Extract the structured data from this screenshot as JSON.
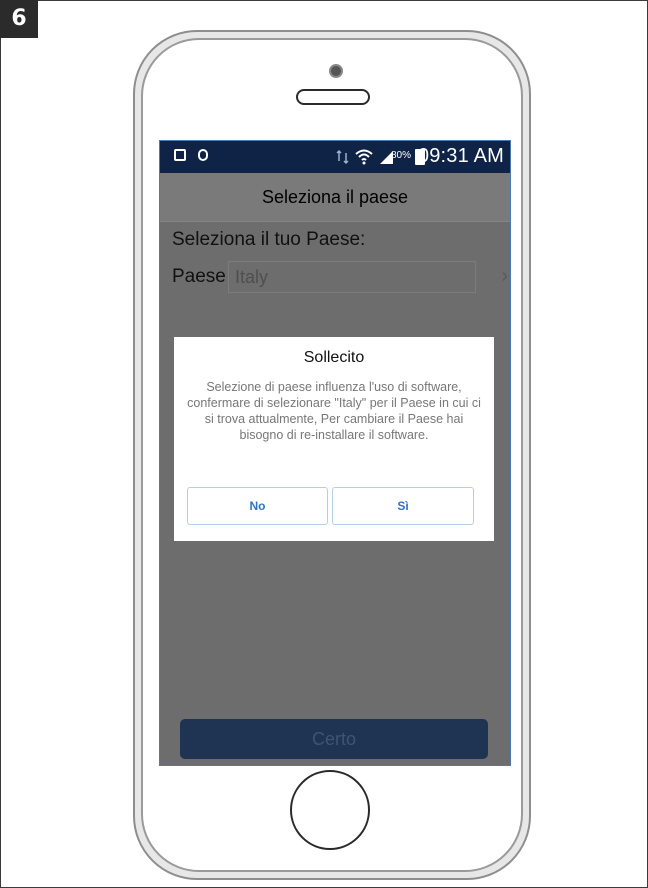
{
  "step_number": "6",
  "status_bar": {
    "battery_percent": "80%",
    "time": "09:31 AM",
    "icons": [
      "gallery-icon",
      "shield-icon",
      "data-transfer-icon",
      "wifi-icon",
      "signal-icon",
      "battery-icon"
    ]
  },
  "header": {
    "title": "Seleziona il paese"
  },
  "form": {
    "section_label": "Seleziona il tuo Paese:",
    "country_label": "Paese",
    "country_value": "Italy"
  },
  "dialog": {
    "title": "Sollecito",
    "message": "Selezione di paese influenza l'uso di software, confermare di selezionare \"Italy\" per il Paese in cui ci si trova attualmente, Per cambiare il Paese hai bisogno di re-installare il software.",
    "no_label": "No",
    "yes_label": "Sì"
  },
  "footer": {
    "confirm_label": "Certo"
  },
  "colors": {
    "status_bar": "#0f2346",
    "dialog_button_text": "#2f73c8",
    "confirm_button": "#1f3452"
  }
}
